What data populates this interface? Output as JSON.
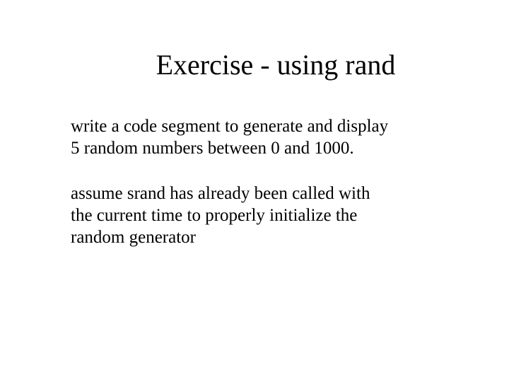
{
  "title": "Exercise - using rand",
  "paragraphs": [
    "write a code segment to generate  and display 5 random numbers between 0 and 1000.",
    "assume srand has already been called with the current time to properly initialize the random generator"
  ]
}
